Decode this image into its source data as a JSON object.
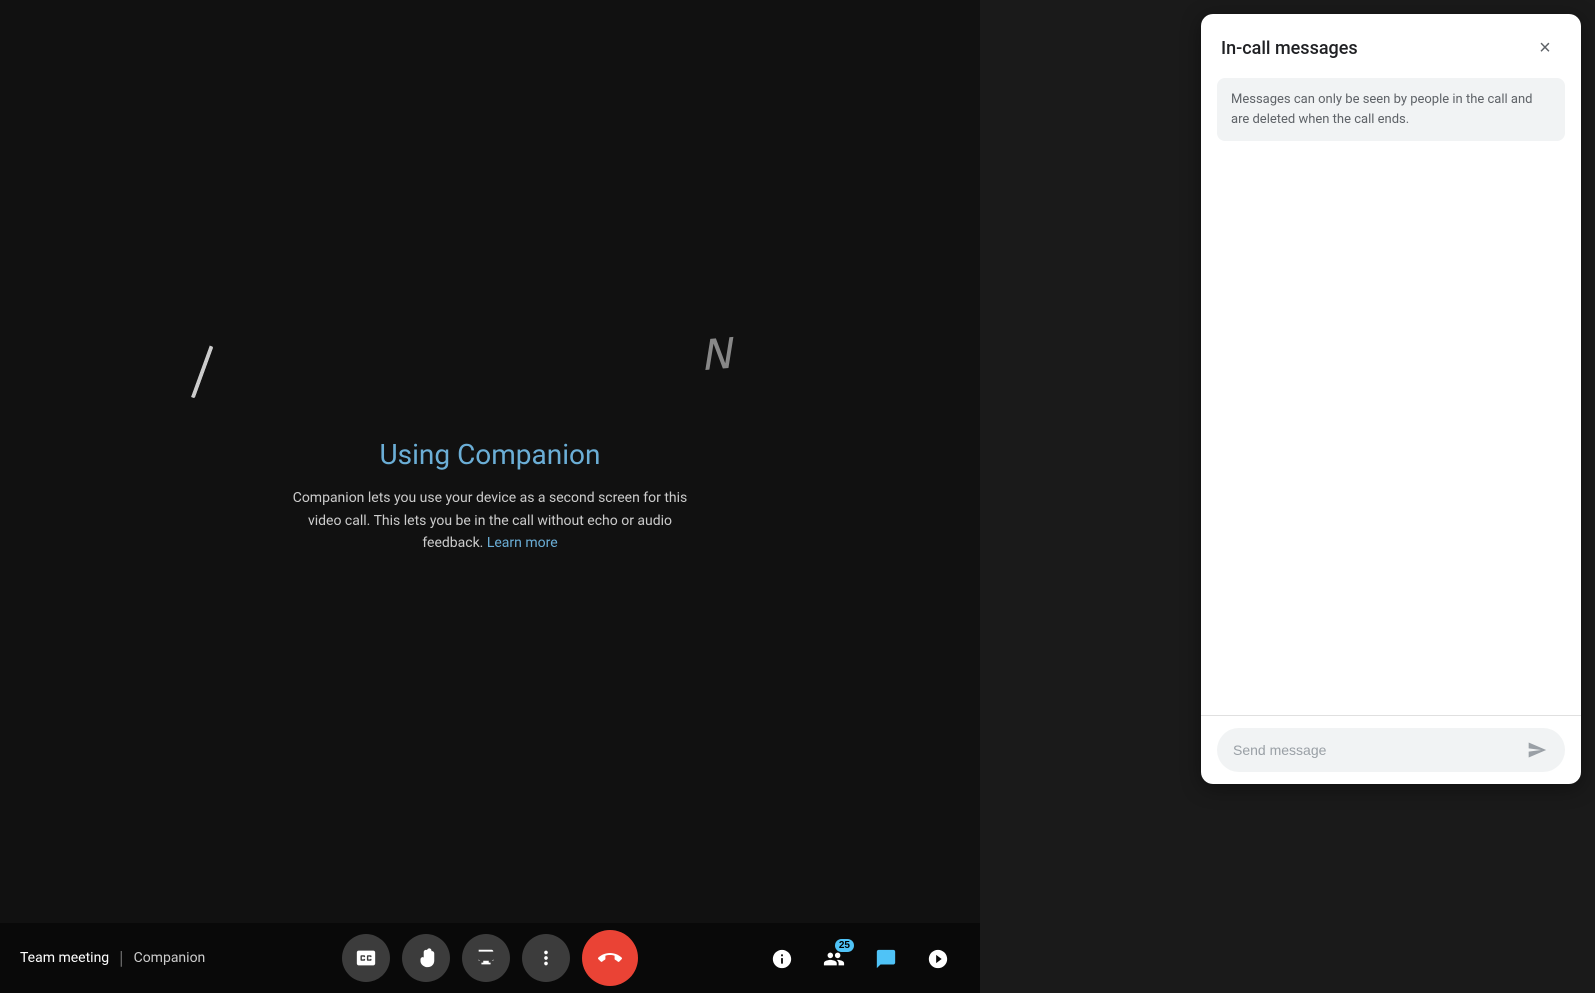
{
  "meeting": {
    "title": "Team meeting",
    "separator": "|",
    "companion_label": "Companion"
  },
  "main_content": {
    "heading": "Using Companion",
    "description_before_link": "Companion lets you use your device as a second screen for this video call. This lets you be in the call without echo or audio feedback.",
    "learn_more_label": "Learn more"
  },
  "controls": {
    "captions_label": "Captions",
    "raise_hand_label": "Raise hand",
    "present_label": "Present",
    "more_options_label": "More options",
    "end_call_label": "End call"
  },
  "right_icons": {
    "info_label": "Info",
    "people_label": "People",
    "chat_label": "Chat",
    "activities_label": "Activities",
    "chat_badge": "25"
  },
  "messages_panel": {
    "title": "In-call messages",
    "close_label": "×",
    "info_text": "Messages can only be seen by people in the call and are deleted when the call ends.",
    "send_placeholder": "Send message"
  }
}
